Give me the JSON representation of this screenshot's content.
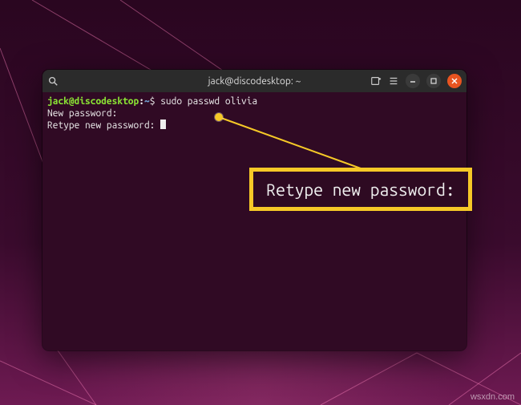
{
  "window": {
    "title": "jack@discodesktop: ~"
  },
  "terminal": {
    "prompt_userhost": "jack@discodesktop",
    "prompt_sep": ":",
    "prompt_path": "~",
    "prompt_symbol": "$",
    "command": "sudo passwd olivia",
    "line2": "New password:",
    "line3": "Retype new password: "
  },
  "callout": {
    "text": "Retype new password:"
  },
  "watermark": "wsxdn.com"
}
